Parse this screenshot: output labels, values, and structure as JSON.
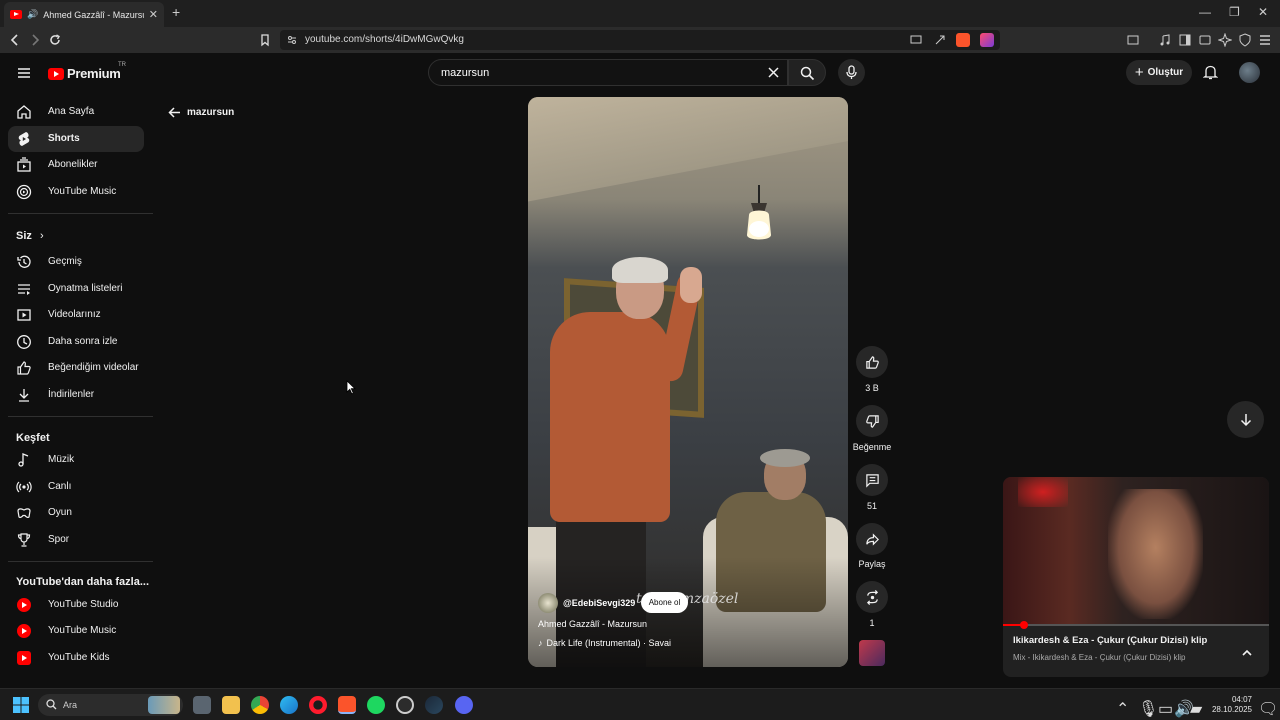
{
  "browser": {
    "tab_title": "Ahmed Gazzâlî - Mazursun - YouTube",
    "url": "youtube.com/shorts/4iDwMGwQvkg"
  },
  "header": {
    "logo": "Premium",
    "logo_region": "TR",
    "search_query": "mazursun",
    "create_label": "Oluştur"
  },
  "sidebar": {
    "main": [
      {
        "label": "Ana Sayfa",
        "icon": "home-icon"
      },
      {
        "label": "Shorts",
        "icon": "shorts-icon",
        "active": true
      },
      {
        "label": "Abonelikler",
        "icon": "subscriptions-icon"
      },
      {
        "label": "YouTube Music",
        "icon": "music-icon"
      }
    ],
    "you_heading": "Siz",
    "you": [
      {
        "label": "Geçmiş",
        "icon": "history-icon"
      },
      {
        "label": "Oynatma listeleri",
        "icon": "playlist-icon"
      },
      {
        "label": "Videolarınız",
        "icon": "your-videos-icon"
      },
      {
        "label": "Daha sonra izle",
        "icon": "watch-later-icon"
      },
      {
        "label": "Beğendiğim videolar",
        "icon": "liked-icon"
      },
      {
        "label": "İndirilenler",
        "icon": "download-icon"
      }
    ],
    "explore_heading": "Keşfet",
    "explore": [
      {
        "label": "Müzik",
        "icon": "music-note-icon"
      },
      {
        "label": "Canlı",
        "icon": "live-icon"
      },
      {
        "label": "Oyun",
        "icon": "gaming-icon"
      },
      {
        "label": "Spor",
        "icon": "trophy-icon"
      }
    ],
    "more_heading": "YouTube'dan daha fazla...",
    "more": [
      {
        "label": "YouTube Studio"
      },
      {
        "label": "YouTube Music"
      },
      {
        "label": "YouTube Kids"
      }
    ]
  },
  "back": {
    "label": "mazursun"
  },
  "short": {
    "channel": "@EdebiSevgi329",
    "subscribe_label": "Abone ol",
    "title": "Ahmed Gazzâlî - Mazursun",
    "music": "Dark Life (Instrumental) · Savai",
    "overlay_text": "tolı hamzaözel"
  },
  "actions": {
    "likes": "3 B",
    "dislike_label": "Beğenme",
    "comments": "51",
    "share_label": "Paylaş",
    "remix_count": "1"
  },
  "miniplayer": {
    "title": "Ikikardesh & Eza - Çukur (Çukur Dizisi) klip",
    "subtitle": "Mix - Ikikardesh & Eza - Çukur (Çukur Dizisi) klip",
    "progress": 0.08
  },
  "taskbar": {
    "search_label": "Ara",
    "time": "04:07",
    "date": "28.10.2025"
  },
  "colors": {
    "brand": "#ff0000",
    "background": "#0f0f0f",
    "surface": "#272727"
  }
}
